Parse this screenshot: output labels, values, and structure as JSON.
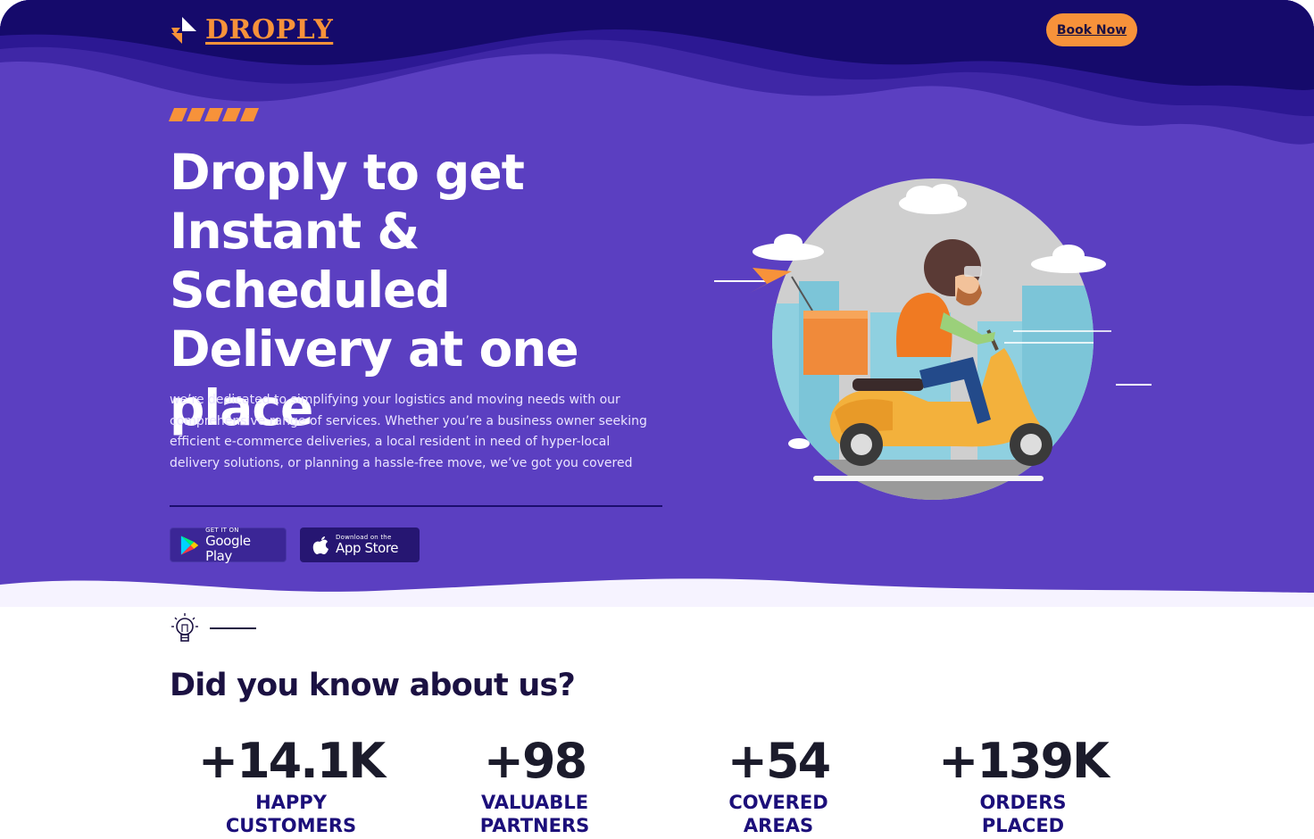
{
  "brand": {
    "name": "DROPLY",
    "accent": "#f7923a",
    "dark_navy": "#150a6b",
    "purple": "#5b3fc1"
  },
  "header": {
    "book_label": "Book Now"
  },
  "hero": {
    "headline": "Droply to get Instant & Scheduled Delivery at one place",
    "description": "we’re dedicated to simplifying your logistics and moving needs with our comprehensive range of services. Whether you’re a business owner seeking efficient e-commerce deliveries, a local resident in need of hyper-local delivery solutions, or planning a hassle-free move, we’ve got you covered",
    "google_play": {
      "small": "GET IT ON",
      "big": "Google Play",
      "icon": "google-play-icon"
    },
    "app_store": {
      "small": "Download on the",
      "big": "App Store",
      "icon": "apple-icon"
    },
    "illustration": "delivery-scooter-illustration"
  },
  "about": {
    "icon": "lightbulb-icon",
    "title": "Did you know about us?",
    "stats": [
      {
        "value": "+14.1K",
        "label_line1": "HAPPY",
        "label_line2": "CUSTOMERS"
      },
      {
        "value": "+98",
        "label_line1": "VALUABLE",
        "label_line2": "PARTNERS"
      },
      {
        "value": "+54",
        "label_line1": "COVERED",
        "label_line2": "AREAS"
      },
      {
        "value": "+139K",
        "label_line1": "ORDERS",
        "label_line2": "PLACED"
      }
    ]
  }
}
